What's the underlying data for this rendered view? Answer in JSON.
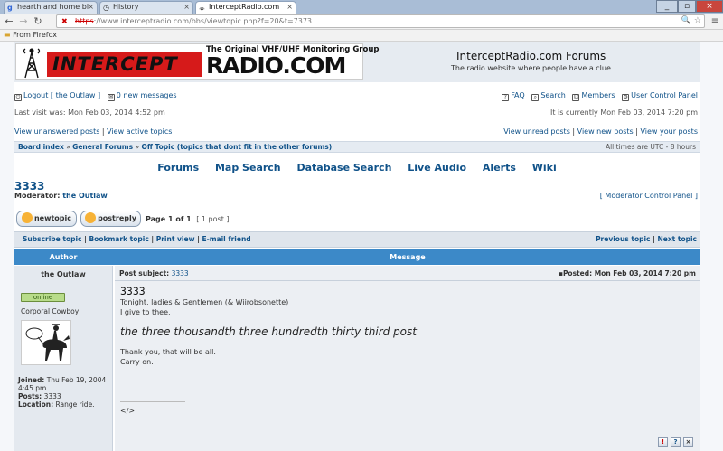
{
  "browser": {
    "tabs": [
      {
        "title": "hearth and home bl"
      },
      {
        "title": "History"
      },
      {
        "title": "InterceptRadio.com"
      }
    ],
    "url_scheme": "https",
    "url_rest": "://www.interceptradio.com/bbs/viewtopic.php?f=20&t=7373",
    "bookmark_folder": "From Firefox"
  },
  "header": {
    "logo_tagline": "The Original VHF/UHF Monitoring Group",
    "logo_intercept": "INTERCEPT",
    "logo_radio": "RADIO.COM",
    "site_title": "InterceptRadio.com Forums",
    "site_desc": "The radio website where people have a clue."
  },
  "user": {
    "logout": "Logout [ the Outlaw ]",
    "messages": "0 new messages",
    "faq": "FAQ",
    "search": "Search",
    "members": "Members",
    "ucp": "User Control Panel",
    "last_visit": "Last visit was: Mon Feb 03, 2014 4:52 pm",
    "current_time": "It is currently Mon Feb 03, 2014 7:20 pm",
    "view_unanswered": "View unanswered posts",
    "view_active": "View active topics",
    "view_unread": "View unread posts",
    "view_new": "View new posts",
    "view_yours": "View your posts"
  },
  "breadcrumb": {
    "board_index": "Board index",
    "general": "General Forums",
    "offtopic": "Off Topic (topics that dont fit in the other forums)",
    "timezone": "All times are UTC - 8 hours"
  },
  "menu": [
    "Forums",
    "Map Search",
    "Database Search",
    "Live Audio",
    "Alerts",
    "Wiki"
  ],
  "topic": {
    "title": "3333",
    "moderator_label": "Moderator:",
    "moderator": "the Outlaw",
    "mcp": "[ Moderator Control Panel ]",
    "newtopic": "newtopic",
    "postreply": "postreply",
    "page_of": "Page 1 of 1",
    "post_count": "[ 1 post ]",
    "subscribe": "Subscribe topic",
    "bookmark": "Bookmark topic",
    "print": "Print view",
    "email": "E-mail friend",
    "previous": "Previous topic",
    "next": "Next topic"
  },
  "table": {
    "author_header": "Author",
    "message_header": "Message"
  },
  "post": {
    "author": "the Outlaw",
    "status": "online",
    "rank": "Corporal Cowboy",
    "joined_label": "Joined:",
    "joined": "Thu Feb 19, 2004 4:45 pm",
    "posts_label": "Posts:",
    "posts": "3333",
    "location_label": "Location:",
    "location": "Range ride.",
    "subject_label": "Post subject:",
    "subject": "3333",
    "posted": "Posted: Mon Feb 03, 2014 7:20 pm",
    "body_title": "3333",
    "line1": "Tonight, ladies & Gentlemen (& Wiirobsonette)",
    "line2": "I give to thee,",
    "big": "the three thousandth three hundredth thirty third post",
    "line3": "Thank you, that will be all.",
    "line4": "Carry on.",
    "signature": "</>"
  },
  "colors": {
    "header_blue": "#3c89c8",
    "logo_red": "#d61a1a",
    "link": "#105289"
  }
}
